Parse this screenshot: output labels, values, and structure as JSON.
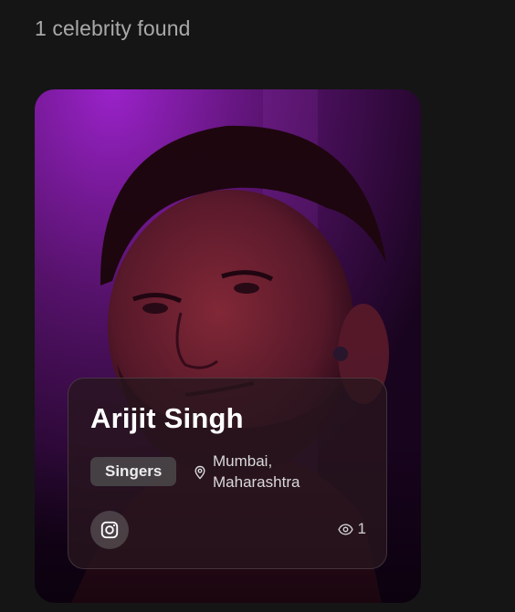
{
  "results": {
    "count_text": "1 celebrity found"
  },
  "celebrity": {
    "name": "Arijit Singh",
    "category": "Singers",
    "location_line1": "Mumbai,",
    "location_line2": "Maharashtra",
    "views": "1",
    "social_icon": "instagram-icon",
    "location_icon": "map-pin-icon",
    "views_icon": "eye-icon"
  },
  "colors": {
    "background": "#151515",
    "card_gradient_top": "#8a1fbf",
    "card_gradient_bottom": "#1a0420",
    "panel": "#28161e",
    "text_primary": "#ffffff",
    "text_muted": "#a9a9a9"
  }
}
